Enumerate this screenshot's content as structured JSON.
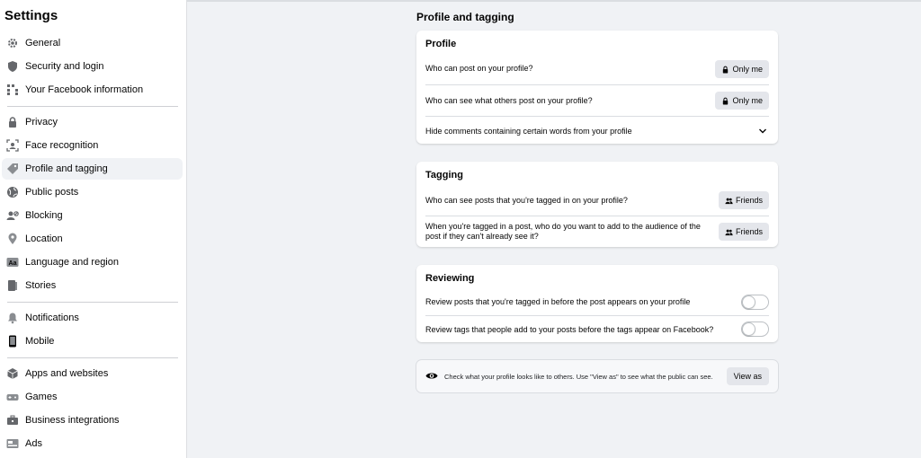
{
  "sidebar": {
    "title": "Settings",
    "items": [
      {
        "label": "General",
        "icon": "gear-icon"
      },
      {
        "label": "Security and login",
        "icon": "shield-icon"
      },
      {
        "label": "Your Facebook information",
        "icon": "grid-icon"
      },
      {
        "label": "Privacy",
        "icon": "lock-icon"
      },
      {
        "label": "Face recognition",
        "icon": "face-scan-icon"
      },
      {
        "label": "Profile and tagging",
        "icon": "tag-icon"
      },
      {
        "label": "Public posts",
        "icon": "globe-icon"
      },
      {
        "label": "Blocking",
        "icon": "block-user-icon"
      },
      {
        "label": "Location",
        "icon": "location-pin-icon"
      },
      {
        "label": "Language and region",
        "icon": "language-icon"
      },
      {
        "label": "Stories",
        "icon": "book-icon"
      },
      {
        "label": "Notifications",
        "icon": "bell-icon"
      },
      {
        "label": "Mobile",
        "icon": "phone-icon"
      },
      {
        "label": "Apps and websites",
        "icon": "cube-icon"
      },
      {
        "label": "Games",
        "icon": "gamepad-icon"
      },
      {
        "label": "Business integrations",
        "icon": "business-icon"
      },
      {
        "label": "Ads",
        "icon": "ads-icon"
      }
    ]
  },
  "main": {
    "title": "Profile and tagging",
    "profile": {
      "heading": "Profile",
      "rows": [
        {
          "text": "Who can post on your profile?",
          "value": "Only me"
        },
        {
          "text": "Who can see what others post on your profile?",
          "value": "Only me"
        },
        {
          "text": "Hide comments containing certain words from your profile"
        }
      ]
    },
    "tagging": {
      "heading": "Tagging",
      "rows": [
        {
          "text": "Who can see posts that you're tagged in on your profile?",
          "value": "Friends"
        },
        {
          "text": "When you're tagged in a post, who do you want to add to the audience of the post if they can't already see it?",
          "value": "Friends"
        }
      ]
    },
    "reviewing": {
      "heading": "Reviewing",
      "rows": [
        {
          "text": "Review posts that you're tagged in before the post appears on your profile",
          "enabled": false
        },
        {
          "text": "Review tags that people add to your posts before the tags appear on Facebook?",
          "enabled": false
        }
      ]
    },
    "view_as": {
      "text": "Check what your profile looks like to others. Use \"View as\" to see what the public can see.",
      "button": "View as"
    }
  },
  "colors": {
    "page_bg": "#f0f2f5",
    "card_bg": "#ffffff",
    "button_bg": "#e4e6eb",
    "active_item_bg": "#f0f2f5"
  }
}
